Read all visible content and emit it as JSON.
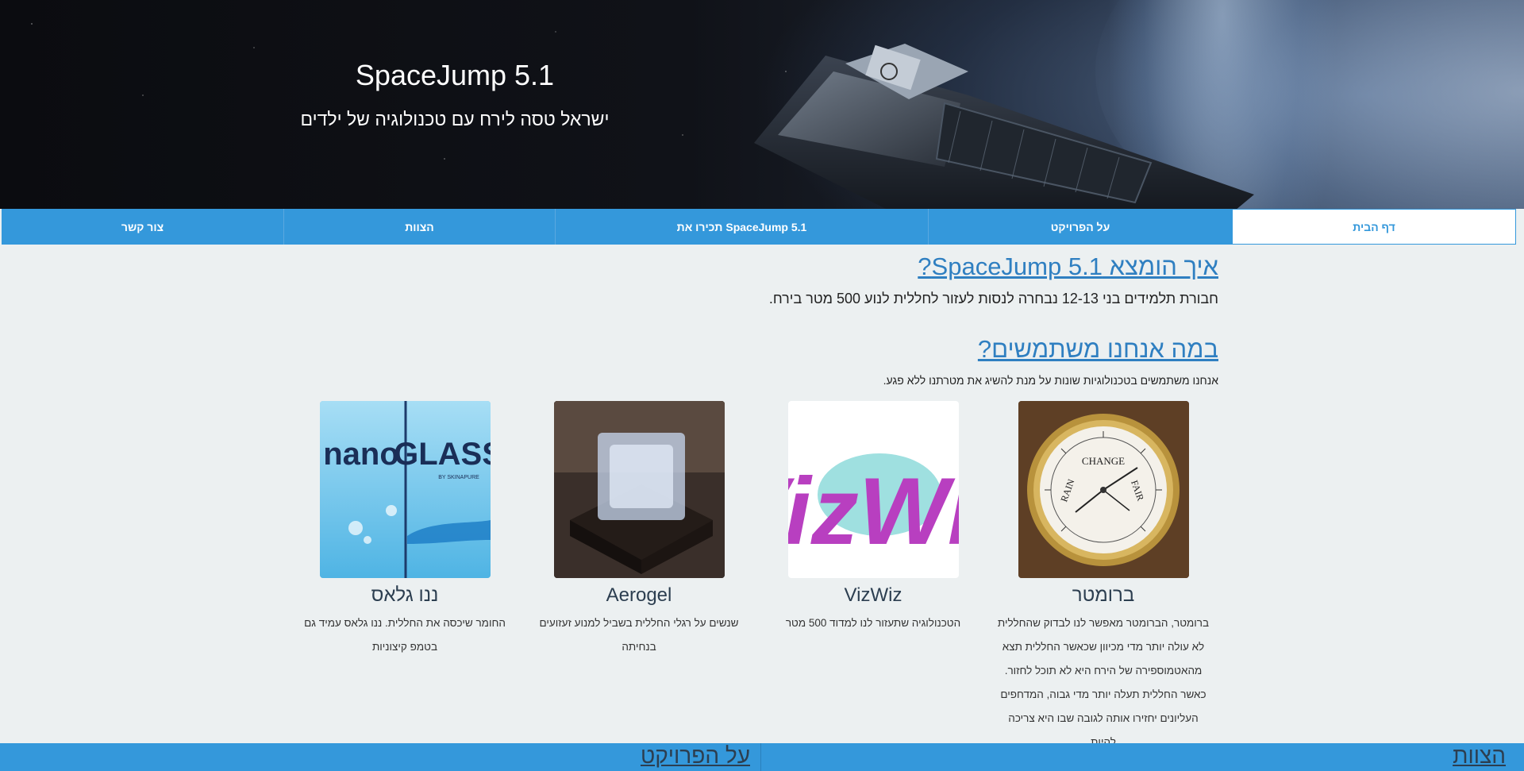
{
  "hero": {
    "title": "SpaceJump 5.1",
    "subtitle": "ישראל טסה לירח עם טכנולוגיה של ילדים"
  },
  "nav": {
    "items": [
      {
        "label": "דף הבית",
        "active": true
      },
      {
        "label": "על הפרויקט",
        "active": false
      },
      {
        "label": "תכירו את SpaceJump 5.1",
        "active": false
      },
      {
        "label": "הצוות",
        "active": false
      },
      {
        "label": "צור קשר",
        "active": false
      }
    ]
  },
  "intro": {
    "heading": "איך הומצא SpaceJump 5.1?",
    "text": "חבורת תלמידים בני 12-13 נבחרה לנסות לעזור לחללית לנוע 500 מטר בירח."
  },
  "tech": {
    "heading": "במה אנחנו משתמשים?",
    "text": "אנחנו משתמשים בטכנולוגיות שונות על מנת להשיג את מטרתנו ללא פגע.",
    "cards": [
      {
        "name": "ברומטר",
        "image": "barometer-photo",
        "lines": [
          "ברומטר, הברומטר מאפשר לנו לבדוק שהחללית",
          "לא עולה יותר מדי מכיוון שכאשר החללית תצא",
          "מהאטמוספירה של הירח היא לא תוכל לחזור.",
          "כאשר החללית תעלה יותר מדי גבוה, המדחפים",
          "העליונים יחזירו אותה לגובה שבו היא צריכה להיות"
        ],
        "dial": {
          "change": "CHANGE",
          "rain": "RAIN",
          "fair": "FAIR"
        }
      },
      {
        "name": "VizWiz",
        "image": "vizwiz-logo",
        "lines": [
          "הטכנולוגיה שתעזור לנו למדוד 500 מטר"
        ],
        "logo_text": "VizWiz"
      },
      {
        "name": "Aerogel",
        "image": "aerogel-photo",
        "lines": [
          "שנשים על רגלי החללית בשביל למנוע זעזועים",
          "בנחיתה"
        ]
      },
      {
        "name": "ננו גלאס",
        "image": "nano-glass-photo",
        "lines": [
          "החומר שיכסה את החללית. ננו גלאס עמיד גם",
          "בטמפ קיצוניות"
        ],
        "logo_left": "nano",
        "logo_right": "GLASS",
        "logo_by": "BY SKINAPURE"
      }
    ]
  },
  "footer": {
    "right_link": "הצוות",
    "left_link": "על הפרויקט"
  },
  "colors": {
    "accent": "#3498db",
    "heading": "#2f7fc1",
    "background": "#ecf0f1"
  }
}
